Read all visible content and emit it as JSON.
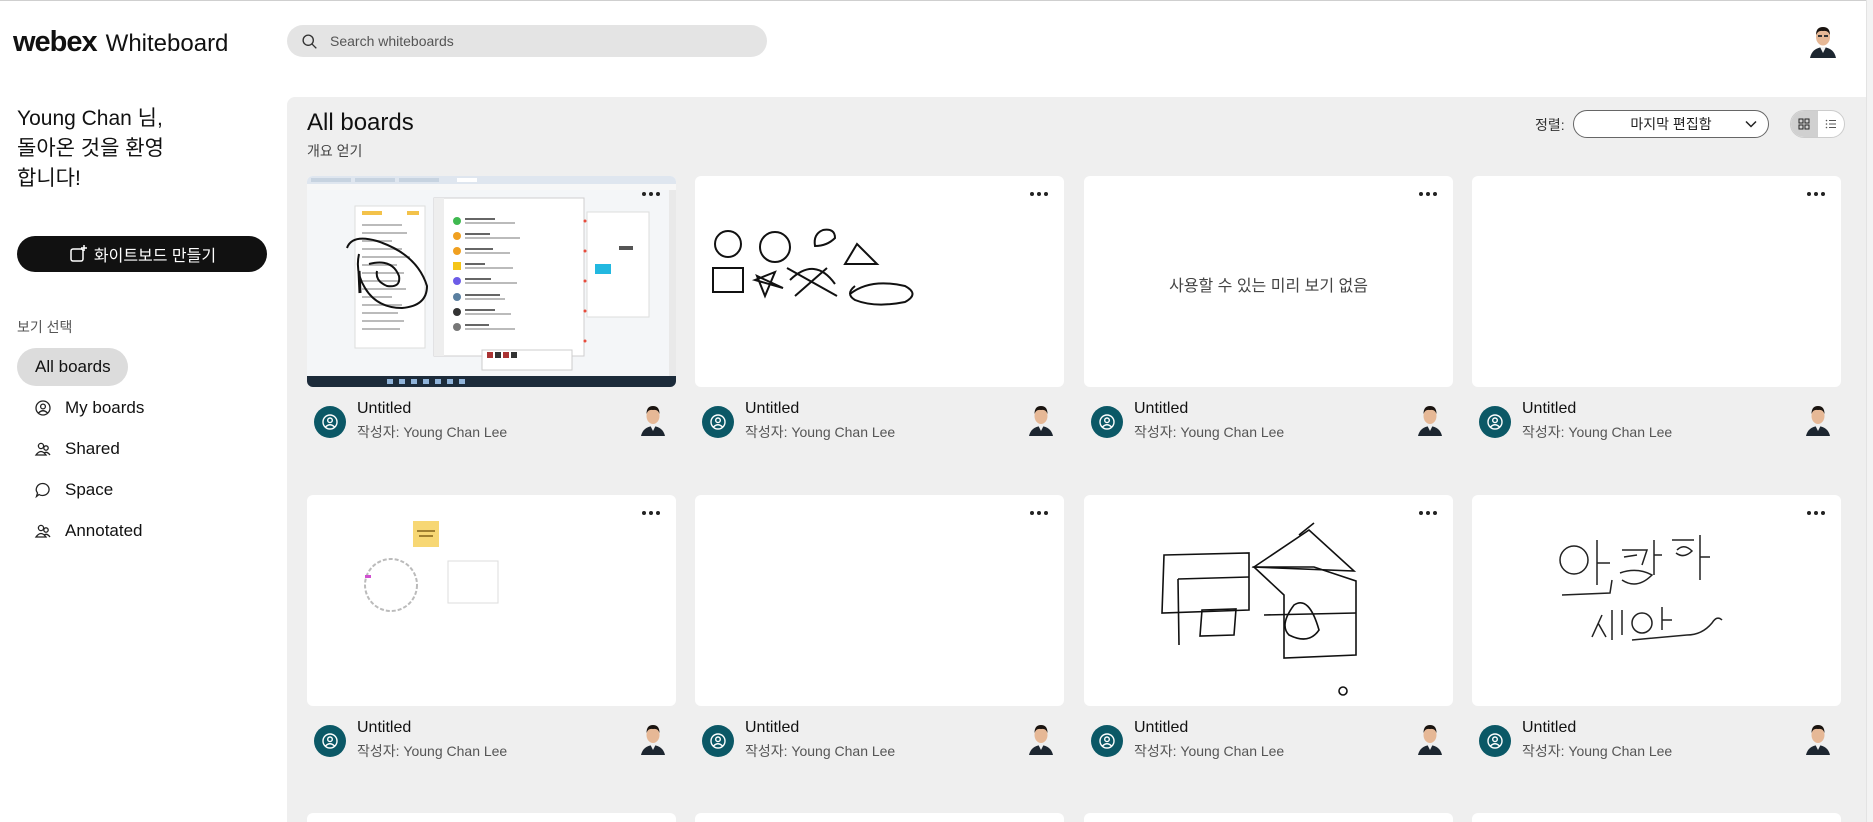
{
  "app": {
    "brand": "webex",
    "product": "Whiteboard"
  },
  "search": {
    "placeholder": "Search whiteboards",
    "icon": "search-icon"
  },
  "sidebar": {
    "welcome_line1": "Young Chan 님,",
    "welcome_line2": "돌아온 것을 환영",
    "welcome_line3": "합니다!",
    "create_label": "화이트보드 만들기",
    "view_label": "보기 선택",
    "items": [
      {
        "label": "All boards",
        "icon": "none",
        "active": true
      },
      {
        "label": "My boards",
        "icon": "person-icon",
        "active": false
      },
      {
        "label": "Shared",
        "icon": "people-icon",
        "active": false
      },
      {
        "label": "Space",
        "icon": "chat-bubble-icon",
        "active": false
      },
      {
        "label": "Annotated",
        "icon": "people-icon",
        "active": false
      }
    ]
  },
  "main": {
    "title": "All boards",
    "subtitle": "개요 얻기",
    "sort_label": "정렬:",
    "sort_value": "마지막 편집함",
    "view_modes": [
      "grid-icon",
      "list-icon"
    ]
  },
  "cards": [
    {
      "title": "Untitled",
      "author": "작성자: Young Chan Lee",
      "preview": "screenshot-annotation"
    },
    {
      "title": "Untitled",
      "author": "작성자: Young Chan Lee",
      "preview": "shapes-drawing"
    },
    {
      "title": "Untitled",
      "author": "작성자: Young Chan Lee",
      "preview": "none",
      "no_preview_text": "사용할 수 있는 미리 보기 없음"
    },
    {
      "title": "Untitled",
      "author": "작성자: Young Chan Lee",
      "preview": "blank"
    },
    {
      "title": "Untitled",
      "author": "작성자: Young Chan Lee",
      "preview": "sticky-circle"
    },
    {
      "title": "Untitled",
      "author": "작성자: Young Chan Lee",
      "preview": "blank"
    },
    {
      "title": "Untitled",
      "author": "작성자: Young Chan Lee",
      "preview": "house-drawing"
    },
    {
      "title": "Untitled",
      "author": "작성자: Young Chan Lee",
      "preview": "handwriting-hello"
    }
  ],
  "colors": {
    "accent": "#0b5866",
    "panel_bg": "#efefef",
    "button_bg": "#111111"
  }
}
